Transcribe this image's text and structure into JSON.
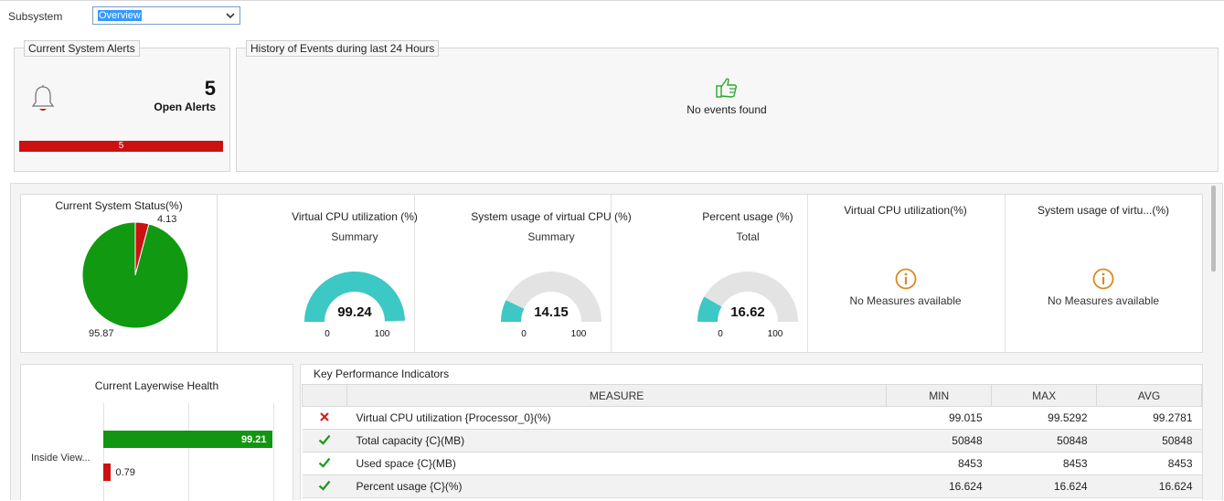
{
  "subsystem": {
    "label": "Subsystem",
    "selected": "Overview"
  },
  "alerts": {
    "title": "Current System Alerts",
    "count": "5",
    "label": "Open Alerts",
    "bar_value": "5",
    "bar_color": "#cc1111"
  },
  "history": {
    "title": "History of Events during last 24 Hours",
    "message": "No events found"
  },
  "status": {
    "title": "Current System Status(%)",
    "slices": [
      {
        "value": 4.13,
        "color": "#cc1111"
      },
      {
        "value": 95.87,
        "color": "#119911"
      }
    ],
    "label_small": "4.13",
    "label_large": "95.87"
  },
  "gauges": [
    {
      "title": "Virtual CPU utilization (%)",
      "sub": "Summary",
      "value": 99.24,
      "display": "99.24",
      "min": "0",
      "max": "100"
    },
    {
      "title": "System usage of virtual CPU (%)",
      "sub": "Summary",
      "value": 14.15,
      "display": "14.15",
      "min": "0",
      "max": "100"
    },
    {
      "title": "Percent usage (%)",
      "sub": "Total",
      "value": 16.62,
      "display": "16.62",
      "min": "0",
      "max": "100"
    }
  ],
  "na_panels": [
    {
      "title": "Virtual CPU utilization(%)",
      "message": "No Measures available"
    },
    {
      "title": "System usage of virtu...(%)",
      "message": "No Measures available"
    }
  ],
  "layer": {
    "title": "Current Layerwise Health",
    "row_label": "Inside View...",
    "good": 99.21,
    "good_label": "99.21",
    "bad": 0.79,
    "bad_label": "0.79"
  },
  "kpi": {
    "title": "Key Performance Indicators",
    "columns": [
      "MEASURE",
      "MIN",
      "MAX",
      "AVG"
    ],
    "rows": [
      {
        "status": "error",
        "measure": "Virtual CPU utilization {Processor_0}(%)",
        "min": "99.015",
        "max": "99.5292",
        "avg": "99.2781"
      },
      {
        "status": "ok",
        "measure": "Total capacity {C}(MB)",
        "min": "50848",
        "max": "50848",
        "avg": "50848"
      },
      {
        "status": "ok",
        "measure": "Used space {C}(MB)",
        "min": "8453",
        "max": "8453",
        "avg": "8453"
      },
      {
        "status": "ok",
        "measure": "Percent usage {C}(%)",
        "min": "16.624",
        "max": "16.624",
        "avg": "16.624"
      }
    ]
  },
  "colors": {
    "gauge_fill": "#3cc8c4",
    "gauge_track": "#e3e3e3",
    "ok": "#1a9a1a",
    "error": "#cc2222",
    "info_icon": "#d98a1f",
    "thumb_icon": "#2ea52e"
  }
}
